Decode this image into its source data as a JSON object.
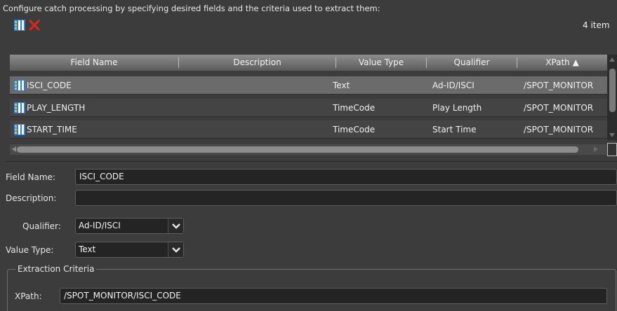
{
  "description_text": "Configure catch processing by specifying desired fields and the criteria used to extract them:",
  "toolbar": {
    "add_icon": "add-field-icon",
    "delete_icon": "delete-icon",
    "item_count": "4 item"
  },
  "table": {
    "columns": [
      "Field Name",
      "Description",
      "Value Type",
      "Qualifier",
      "XPath ▲"
    ],
    "rows": [
      {
        "field_name": "ISCI_CODE",
        "description": "",
        "value_type": "Text",
        "qualifier": "Ad-ID/ISCI",
        "xpath": "/SPOT_MONITOR"
      },
      {
        "field_name": "PLAY_LENGTH",
        "description": "",
        "value_type": "TimeCode",
        "qualifier": "Play Length",
        "xpath": "/SPOT_MONITOR"
      },
      {
        "field_name": "START_TIME",
        "description": "",
        "value_type": "TimeCode",
        "qualifier": "Start Time",
        "xpath": "/SPOT_MONITOR"
      }
    ],
    "selected_row": 0
  },
  "form": {
    "field_name_label": "Field Name:",
    "field_name_value": "ISCI_CODE",
    "description_label": "Description:",
    "description_value": "",
    "qualifier_label": "Qualifier:",
    "qualifier_value": "Ad-ID/ISCI",
    "value_type_label": "Value Type:",
    "value_type_value": "Text",
    "extraction_group_title": "Extraction Criteria",
    "xpath_label": "XPath:",
    "xpath_value": "/SPOT_MONITOR/ISCI_CODE"
  },
  "colors": {
    "background": "#3c3c3c",
    "selected_row": "#6b6b6b",
    "field_bg": "#242424",
    "delete_red": "#d9261c",
    "icon_blue": "#2f7fe0",
    "icon_yellow": "#f2c200"
  }
}
